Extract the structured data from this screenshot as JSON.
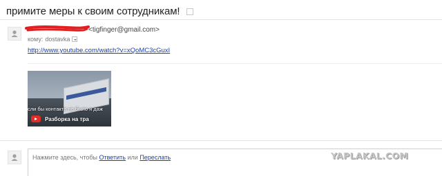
{
  "email": {
    "subject": "примите меры к своим сотрудникам!",
    "sender_email": "<tigfinger@gmail.com>",
    "to_label": "кому:",
    "to_value": "dostavka",
    "link": "http://www.youtube.com/watch?v=xQoMC3cGuxI"
  },
  "video": {
    "caption": "сли бы контакта не было я даж",
    "title": "Разборка на тра"
  },
  "reply": {
    "prefix": "Нажмите здесь, чтобы",
    "reply_link": "Ответить",
    "or": "или",
    "forward_link": "Переслать"
  },
  "watermark": "YAPLAKAL.COM",
  "colors": {
    "link": "#1a3fa8",
    "redaction": "#e02020",
    "youtube_red": "#e52d27"
  },
  "icons": {
    "avatar": "person-icon",
    "play": "youtube-play-icon"
  }
}
